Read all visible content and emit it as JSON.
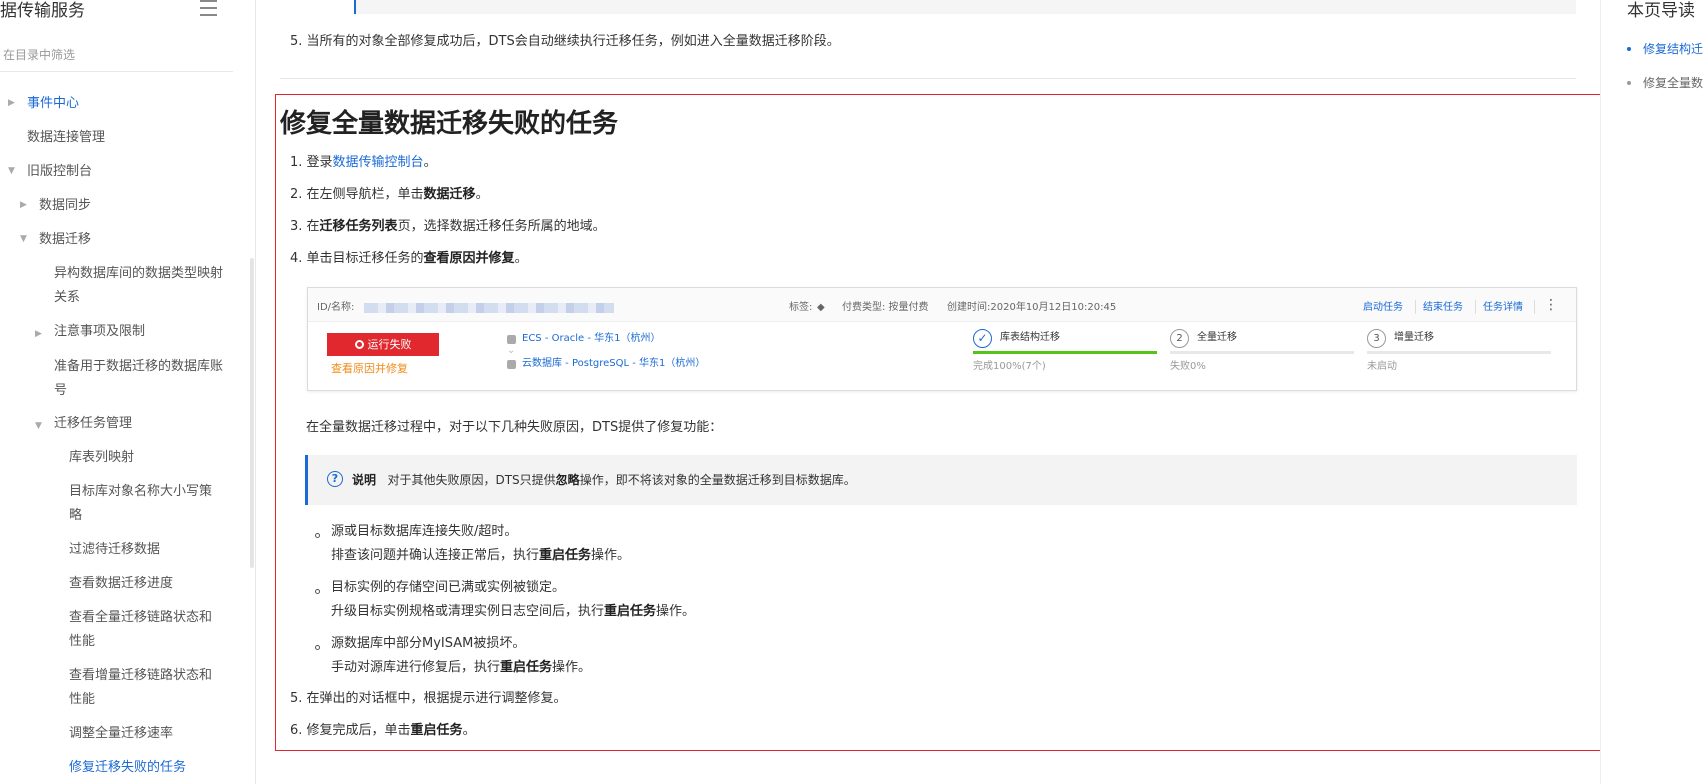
{
  "sidebar": {
    "title": "据传输服务",
    "filter_placeholder": "在目录中筛选",
    "items": [
      {
        "label": "事件中心"
      },
      {
        "label": "数据连接管理"
      },
      {
        "label": "旧版控制台"
      },
      {
        "label": "数据同步"
      },
      {
        "label": "数据迁移"
      },
      {
        "label": "异构数据库间的数据类型映射关系"
      },
      {
        "label": "注意事项及限制"
      },
      {
        "label": "准备用于数据迁移的数据库账号"
      },
      {
        "label": "迁移任务管理"
      },
      {
        "label": "库表列映射"
      },
      {
        "label": "目标库对象名称大小写策略"
      },
      {
        "label": "过滤待迁移数据"
      },
      {
        "label": "查看数据迁移进度"
      },
      {
        "label": "查看全量迁移链路状态和性能"
      },
      {
        "label": "查看增量迁移链路状态和性能"
      },
      {
        "label": "调整全量迁移速率"
      },
      {
        "label": "修复迁移失败的任务"
      }
    ]
  },
  "content": {
    "prev_step5": "5. 当所有的对象全部修复成功后，DTS会自动继续执行迁移任务，例如进入全量数据迁移阶段。",
    "heading": "修复全量数据迁移失败的任务",
    "s1_pre": "1. 登录",
    "s1_link": "数据传输控制台",
    "s1_post": "。",
    "s2_pre": "2. 在左侧导航栏，单击",
    "s2_bold": "数据迁移",
    "s2_post": "。",
    "s3_pre": "3. 在",
    "s3_bold": "迁移任务列表",
    "s3_post": "页，选择数据迁移任务所属的地域。",
    "s4_pre": "4. 单击目标迁移任务的",
    "s4_bold": "查看原因并修复",
    "s4_post": "。",
    "intro": "在全量数据迁移过程中，对于以下几种失败原因，DTS提供了修复功能：",
    "note_label": "说明",
    "note_pre": "对于其他失败原因，DTS只提供",
    "note_bold": "忽略",
    "note_post": "操作，即不将该对象的全量数据迁移到目标数据库。",
    "b1_title": "源或目标数据库连接失败/超时。",
    "b1_pre": "排查该问题并确认连接正常后，执行",
    "b1_bold": "重启任务",
    "b1_post": "操作。",
    "b2_title": "目标实例的存储空间已满或实例被锁定。",
    "b2_pre": "升级目标实例规格或清理实例日志空间后，执行",
    "b2_bold": "重启任务",
    "b2_post": "操作。",
    "b3_title": "源数据库中部分MyISAM被损坏。",
    "b3_pre": "手动对源库进行修复后，执行",
    "b3_bold": "重启任务",
    "b3_post": "操作。",
    "s5": "5. 在弹出的对话框中，根据提示进行调整修复。",
    "s6_pre": "6. 修复完成后，单击",
    "s6_bold": "重启任务",
    "s6_post": "。"
  },
  "console": {
    "id_label": "ID/名称:",
    "tag_label": "标签:",
    "billing": "付费类型: 按量付费",
    "created": "创建时间:2020年10月12日10:20:45",
    "action_start": "启动任务",
    "action_end": "结束任务",
    "action_detail": "任务详情",
    "status": "运行失败",
    "repair_link": "查看原因并修复",
    "source": "ECS - Oracle - 华东1（杭州）",
    "target": "云数据库 - PostgreSQL - 华东1（杭州）",
    "step1_name": "库表结构迁移",
    "step1_status": "完成100%(7个)",
    "step1_progress": 1.0,
    "step2_num": "2",
    "step2_name": "全量迁移",
    "step2_status": "失败0%",
    "step2_progress": 0,
    "step3_num": "3",
    "step3_name": "增量迁移",
    "step3_status": "未启动",
    "step3_progress": 0
  },
  "toc": {
    "title": "本页导读",
    "items": [
      {
        "label": "修复结构迁",
        "active": true
      },
      {
        "label": "修复全量数",
        "active": false
      }
    ]
  },
  "colors": {
    "link": "#1a6ad6",
    "highlight_border": "#e0282e",
    "fail": "#e0282e",
    "repair": "#f08c1a",
    "progress": "#52c41a"
  }
}
